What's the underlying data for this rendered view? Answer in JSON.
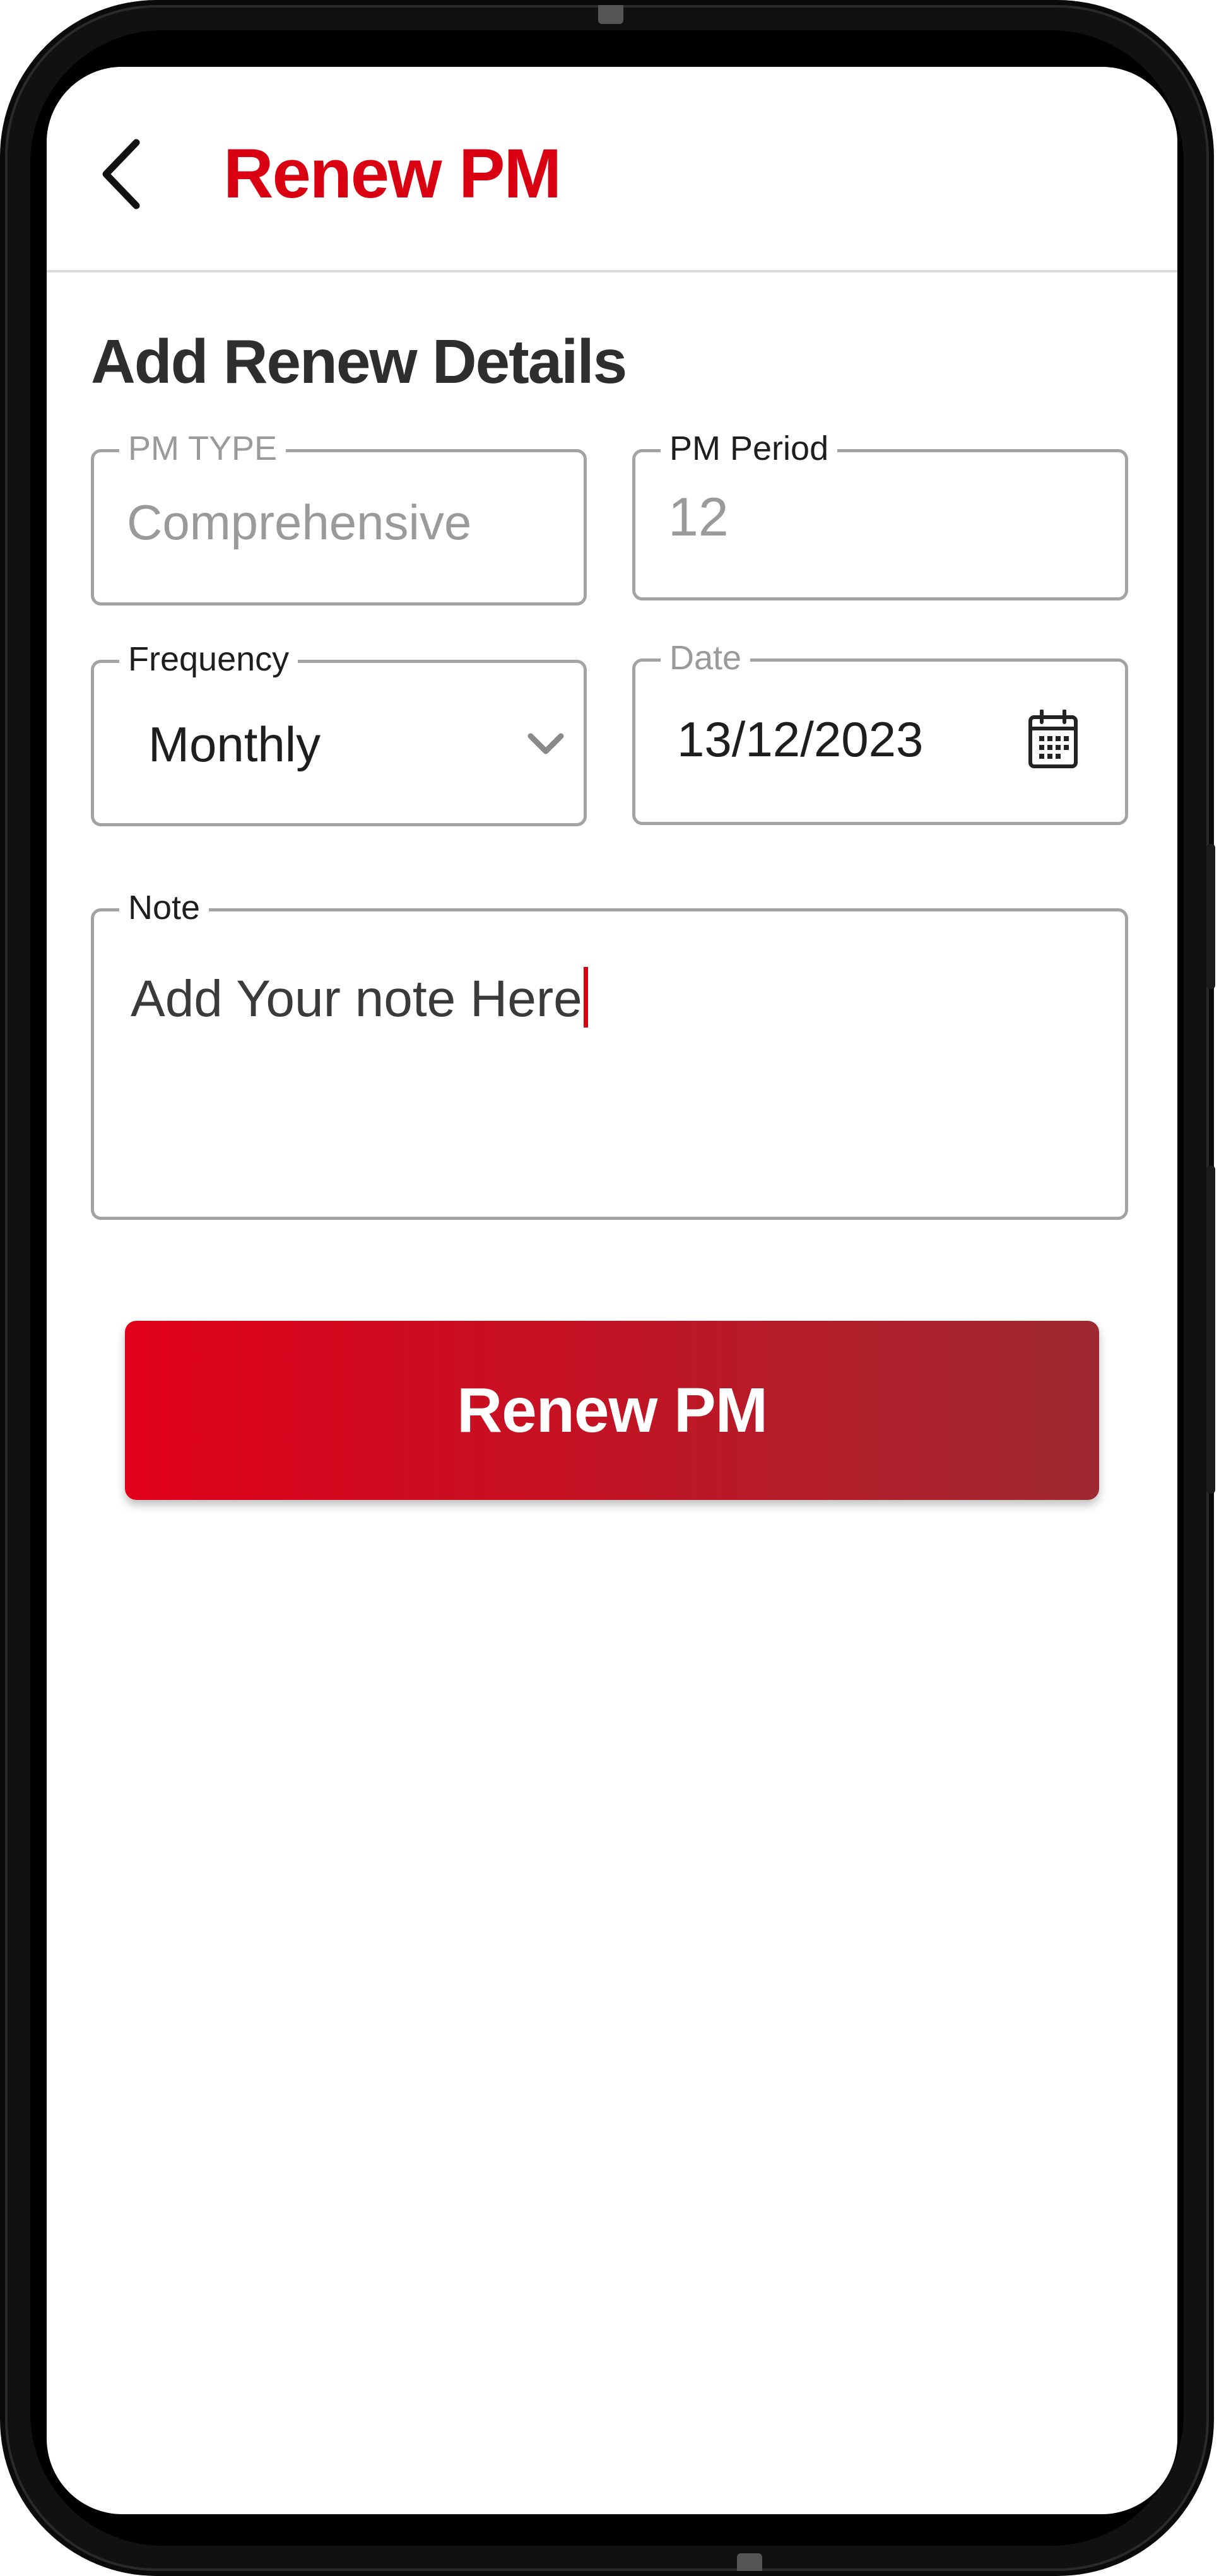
{
  "header": {
    "title": "Renew PM",
    "back_icon": "chevron-left-icon"
  },
  "form": {
    "section_title": "Add Renew Details",
    "pm_type": {
      "label": "PM TYPE",
      "value": "Comprehensive"
    },
    "pm_period": {
      "label": "PM Period",
      "value": "12"
    },
    "frequency": {
      "label": "Frequency",
      "value": "Monthly",
      "icon": "chevron-down-icon"
    },
    "date": {
      "label": "Date",
      "value": "13/12/2023",
      "icon": "calendar-icon"
    },
    "note": {
      "label": "Note",
      "value": "Add Your note Here"
    }
  },
  "actions": {
    "submit_label": "Renew PM"
  },
  "colors": {
    "accent": "#d90012",
    "button_gradient_start": "#e0001a",
    "button_gradient_end": "#9e2930",
    "field_border": "#a3a3a3"
  }
}
